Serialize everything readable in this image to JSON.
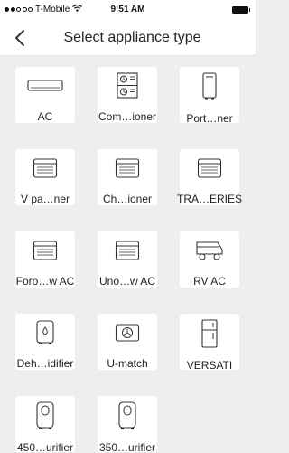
{
  "status_bar": {
    "carrier": "T-Mobile",
    "time": "9:51 AM"
  },
  "header": {
    "title": "Select appliance type"
  },
  "appliances": [
    {
      "label": "AC",
      "icon": "wall-ac-icon"
    },
    {
      "label": "Com…ioner",
      "icon": "combo-ac-icon"
    },
    {
      "label": "Port…ner",
      "icon": "portable-ac-icon"
    },
    {
      "label": "V pa…ner",
      "icon": "panel-ac-icon"
    },
    {
      "label": "Ch…ioner",
      "icon": "panel-ac-icon"
    },
    {
      "label": "TRA…ERIES",
      "icon": "panel-ac-icon"
    },
    {
      "label": "Foro…w AC",
      "icon": "window-ac-icon"
    },
    {
      "label": "Uno…w AC",
      "icon": "window-ac-icon"
    },
    {
      "label": "RV AC",
      "icon": "rv-ac-icon"
    },
    {
      "label": "Deh…idifier",
      "icon": "dehumidifier-icon"
    },
    {
      "label": "U-match",
      "icon": "u-match-icon"
    },
    {
      "label": "VERSATI",
      "icon": "fridge-icon"
    },
    {
      "label": "450…urifier",
      "icon": "purifier-icon"
    },
    {
      "label": "350…urifier",
      "icon": "purifier-icon"
    }
  ]
}
